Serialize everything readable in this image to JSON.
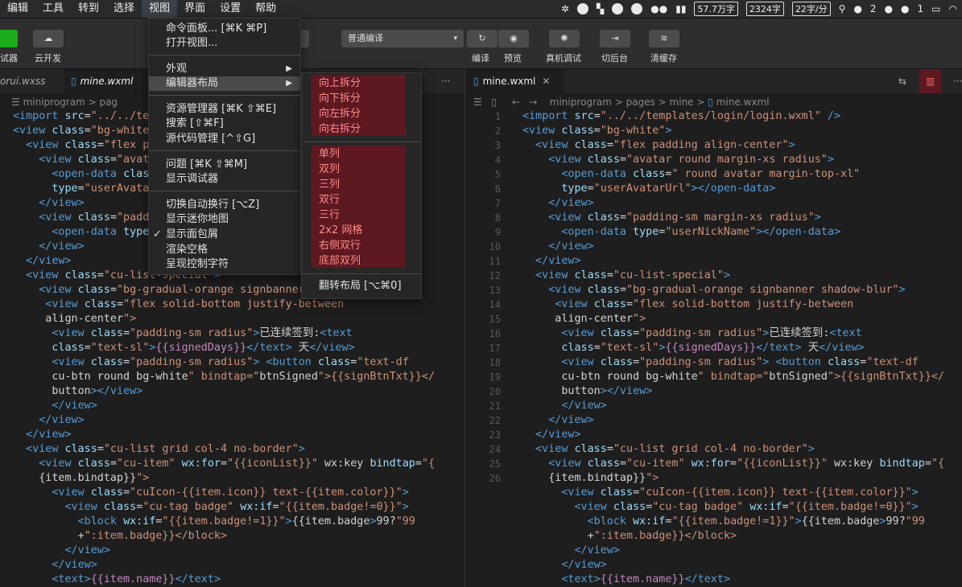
{
  "menubar": {
    "items": [
      "编辑",
      "工具",
      "转到",
      "选择",
      "视图",
      "界面",
      "设置",
      "帮助"
    ],
    "status": {
      "word_count": "57.7万字",
      "chars": "2324字",
      "speed": "22字/分",
      "badge_a": "2",
      "badge_b": "1"
    }
  },
  "toolbar": {
    "left_label_a": "试器",
    "left_label_b": "云开发",
    "compile_mode": "普通编译",
    "compile": "编译",
    "preview": "预览",
    "real_debug": "真机调试",
    "background": "切后台",
    "clear_cache": "清缓存"
  },
  "view_menu": {
    "items": [
      "命令面板... [⌘K ⌘P]",
      "打开视图...",
      "外观",
      "编辑器布局",
      "资源管理器 [⌘K ⇧⌘E]",
      "搜索 [⇧⌘F]",
      "源代码管理 [^⇧G]",
      "问题 [⌘K ⇧⌘M]",
      "显示调试器",
      "切换自动换行 [⌥Z]",
      "显示迷你地图",
      "显示面包屑",
      "渲染空格",
      "呈现控制字符"
    ]
  },
  "layout_submenu": {
    "items": [
      "向上拆分",
      "向下拆分",
      "向左拆分",
      "向右拆分",
      "单列",
      "双列",
      "三列",
      "双行",
      "三行",
      "2x2 网格",
      "右侧双行",
      "底部双列",
      "翻转布局 [⌥⌘0]"
    ]
  },
  "left_pane": {
    "tabs": [
      "orui.wxss",
      "mine.wxml"
    ],
    "breadcrumb": "miniprogram > pag"
  },
  "right_pane": {
    "tab": "mine.wxml",
    "breadcrumb": [
      "miniprogram",
      "pages",
      "mine",
      "mine.wxml"
    ],
    "line_numbers": [
      "1",
      "2",
      "3",
      "4",
      "",
      "5",
      "6",
      "7",
      "8",
      "9",
      "10",
      "11",
      "12",
      "13",
      "",
      "14",
      "",
      "15",
      "",
      "",
      "16",
      "17",
      "18",
      "19",
      "20",
      "",
      "21",
      "22",
      "23",
      "",
      "24",
      "25",
      "26"
    ]
  },
  "code_lines": [
    "<import src=\"../../templates/login/login.wxml\" />",
    "<view class=\"bg-white\">",
    "  <view class=\"flex padding align-center\">",
    "    <view class=\"avatar round margin-xs radius\">",
    "      <open-data class=\" round avatar margin-top-xl\"",
    "      type=\"userAvatarUrl\"></open-data>",
    "    </view>",
    "    <view class=\"padding-sm margin-xs radius\">",
    "      <open-data type=\"userNickName\"></open-data>",
    "    </view>",
    "  </view>",
    "  <view class=\"cu-list-special\">",
    "    <view class=\"bg-gradual-orange signbanner shadow-blur\">",
    "     <view class=\"flex solid-bottom justify-between",
    "     align-center\">",
    "      <view class=\"padding-sm radius\">已连续签到:<text",
    "      class=\"text-sl\">{{signedDays}}</text> 天</view>",
    "      <view class=\"padding-sm radius\"> <button class=\"text-df",
    "      cu-btn round bg-white\" bindtap=\"btnSigned\">{{signBtnTxt}}</",
    "      button></view>",
    "      </view>",
    "    </view>",
    "  </view>",
    "  <view class=\"cu-list grid col-4 no-border\">",
    "    <view class=\"cu-item\" wx:for=\"{{iconList}}\" wx:key bindtap=\"{",
    "    {item.bindtap}}\">",
    "      <view class=\"cuIcon-{{item.icon}} text-{{item.color}}\">",
    "        <view class=\"cu-tag badge\" wx:if=\"{{item.badge!=0}}\">",
    "          <block wx:if=\"{{item.badge!=1}}\">{{item.badge>99?\"99",
    "          +\":item.badge}}</block>",
    "        </view>",
    "      </view>",
    "      <text>{{item.name}}</text>"
  ]
}
